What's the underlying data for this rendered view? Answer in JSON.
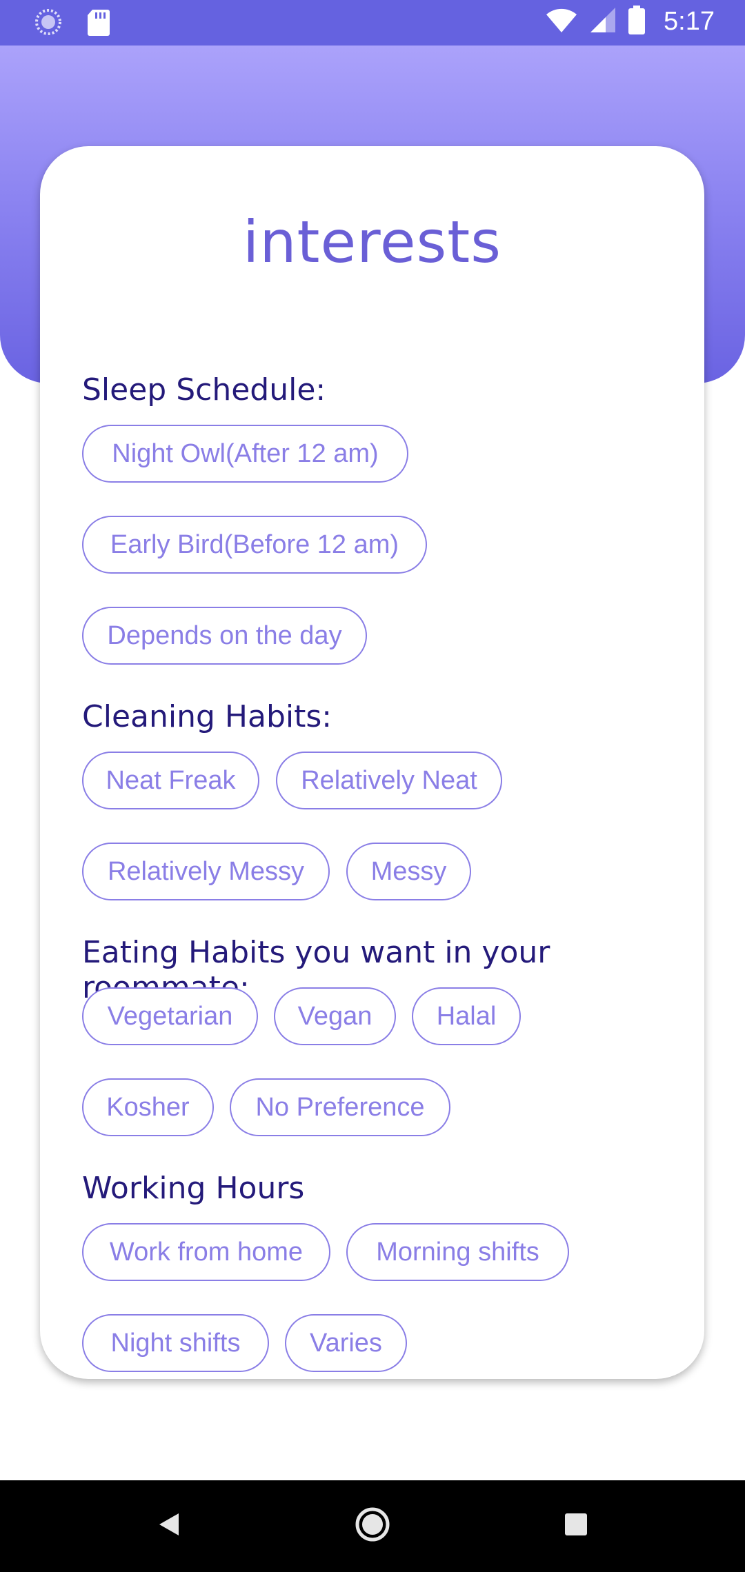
{
  "status_bar": {
    "time": "5:17",
    "left_icons": [
      "loading-icon",
      "sd-card-icon"
    ],
    "right_icons": [
      "wifi-icon",
      "cellular-signal-icon",
      "battery-icon"
    ]
  },
  "page": {
    "title": "interests"
  },
  "sections": [
    {
      "title": "Sleep Schedule:",
      "options": [
        "Night Owl(After 12 am)",
        "Early Bird(Before 12 am)",
        "Depends on the day"
      ]
    },
    {
      "title": "Cleaning Habits:",
      "options": [
        "Neat Freak",
        "Relatively Neat",
        "Relatively Messy",
        "Messy"
      ]
    },
    {
      "title": "Eating Habits you want in your roommate:",
      "options": [
        "Vegetarian",
        "Vegan",
        "Halal",
        "Kosher",
        "No Preference"
      ]
    },
    {
      "title": "Working Hours",
      "options": [
        "Work from home",
        "Morning shifts",
        "Night shifts",
        "Varies"
      ]
    }
  ],
  "nav_bar": {
    "buttons": [
      "back-icon",
      "home-icon",
      "recents-icon"
    ]
  },
  "colors": {
    "status_bar": "#6562e0",
    "header_gradient_top": "#aba2fb",
    "header_gradient_bottom": "#6a63e2",
    "section_title": "#241a7a",
    "chip_accent": "#8a7ee6"
  }
}
